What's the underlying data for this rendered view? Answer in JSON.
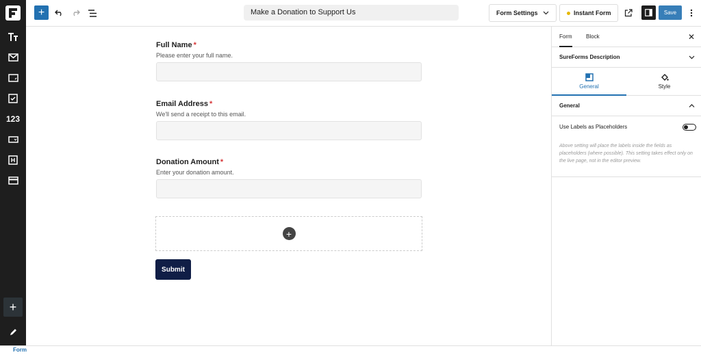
{
  "topbar": {
    "title": "Make a Donation to Support Us",
    "form_settings_label": "Form Settings",
    "instant_form_label": "Instant Form",
    "save_label": "Save"
  },
  "sidebar": {
    "items": [
      {
        "icon": "text-icon"
      },
      {
        "icon": "email-icon"
      },
      {
        "icon": "textarea-icon"
      },
      {
        "icon": "checkbox-icon"
      },
      {
        "icon": "number-icon",
        "label": "123"
      },
      {
        "icon": "dropdown-icon"
      },
      {
        "icon": "heading-icon"
      },
      {
        "icon": "payment-icon"
      }
    ]
  },
  "form": {
    "fields": [
      {
        "label": "Full Name",
        "required": "*",
        "help": "Please enter your full name."
      },
      {
        "label": "Email Address",
        "required": "*",
        "help": "We'll send a receipt to this email."
      },
      {
        "label": "Donation Amount",
        "required": "*",
        "help": "Enter your donation amount."
      }
    ],
    "submit_label": "Submit"
  },
  "panel": {
    "tabs": [
      "Form",
      "Block"
    ],
    "block_description": "SureForms Description",
    "sub_tabs": [
      "General",
      "Style"
    ],
    "general_heading": "General",
    "toggle_label": "Use Labels as Placeholders",
    "help_text": "Above setting will place the labels inside the fields as placeholders (where possible). This setting takes effect only on the live page, not in the editor preview."
  },
  "footer": {
    "breadcrumb": "Form"
  },
  "colors": {
    "accent": "#2271b1",
    "submit": "#101e46",
    "required": "#d63638",
    "sidebar": "#1e1e1e"
  }
}
